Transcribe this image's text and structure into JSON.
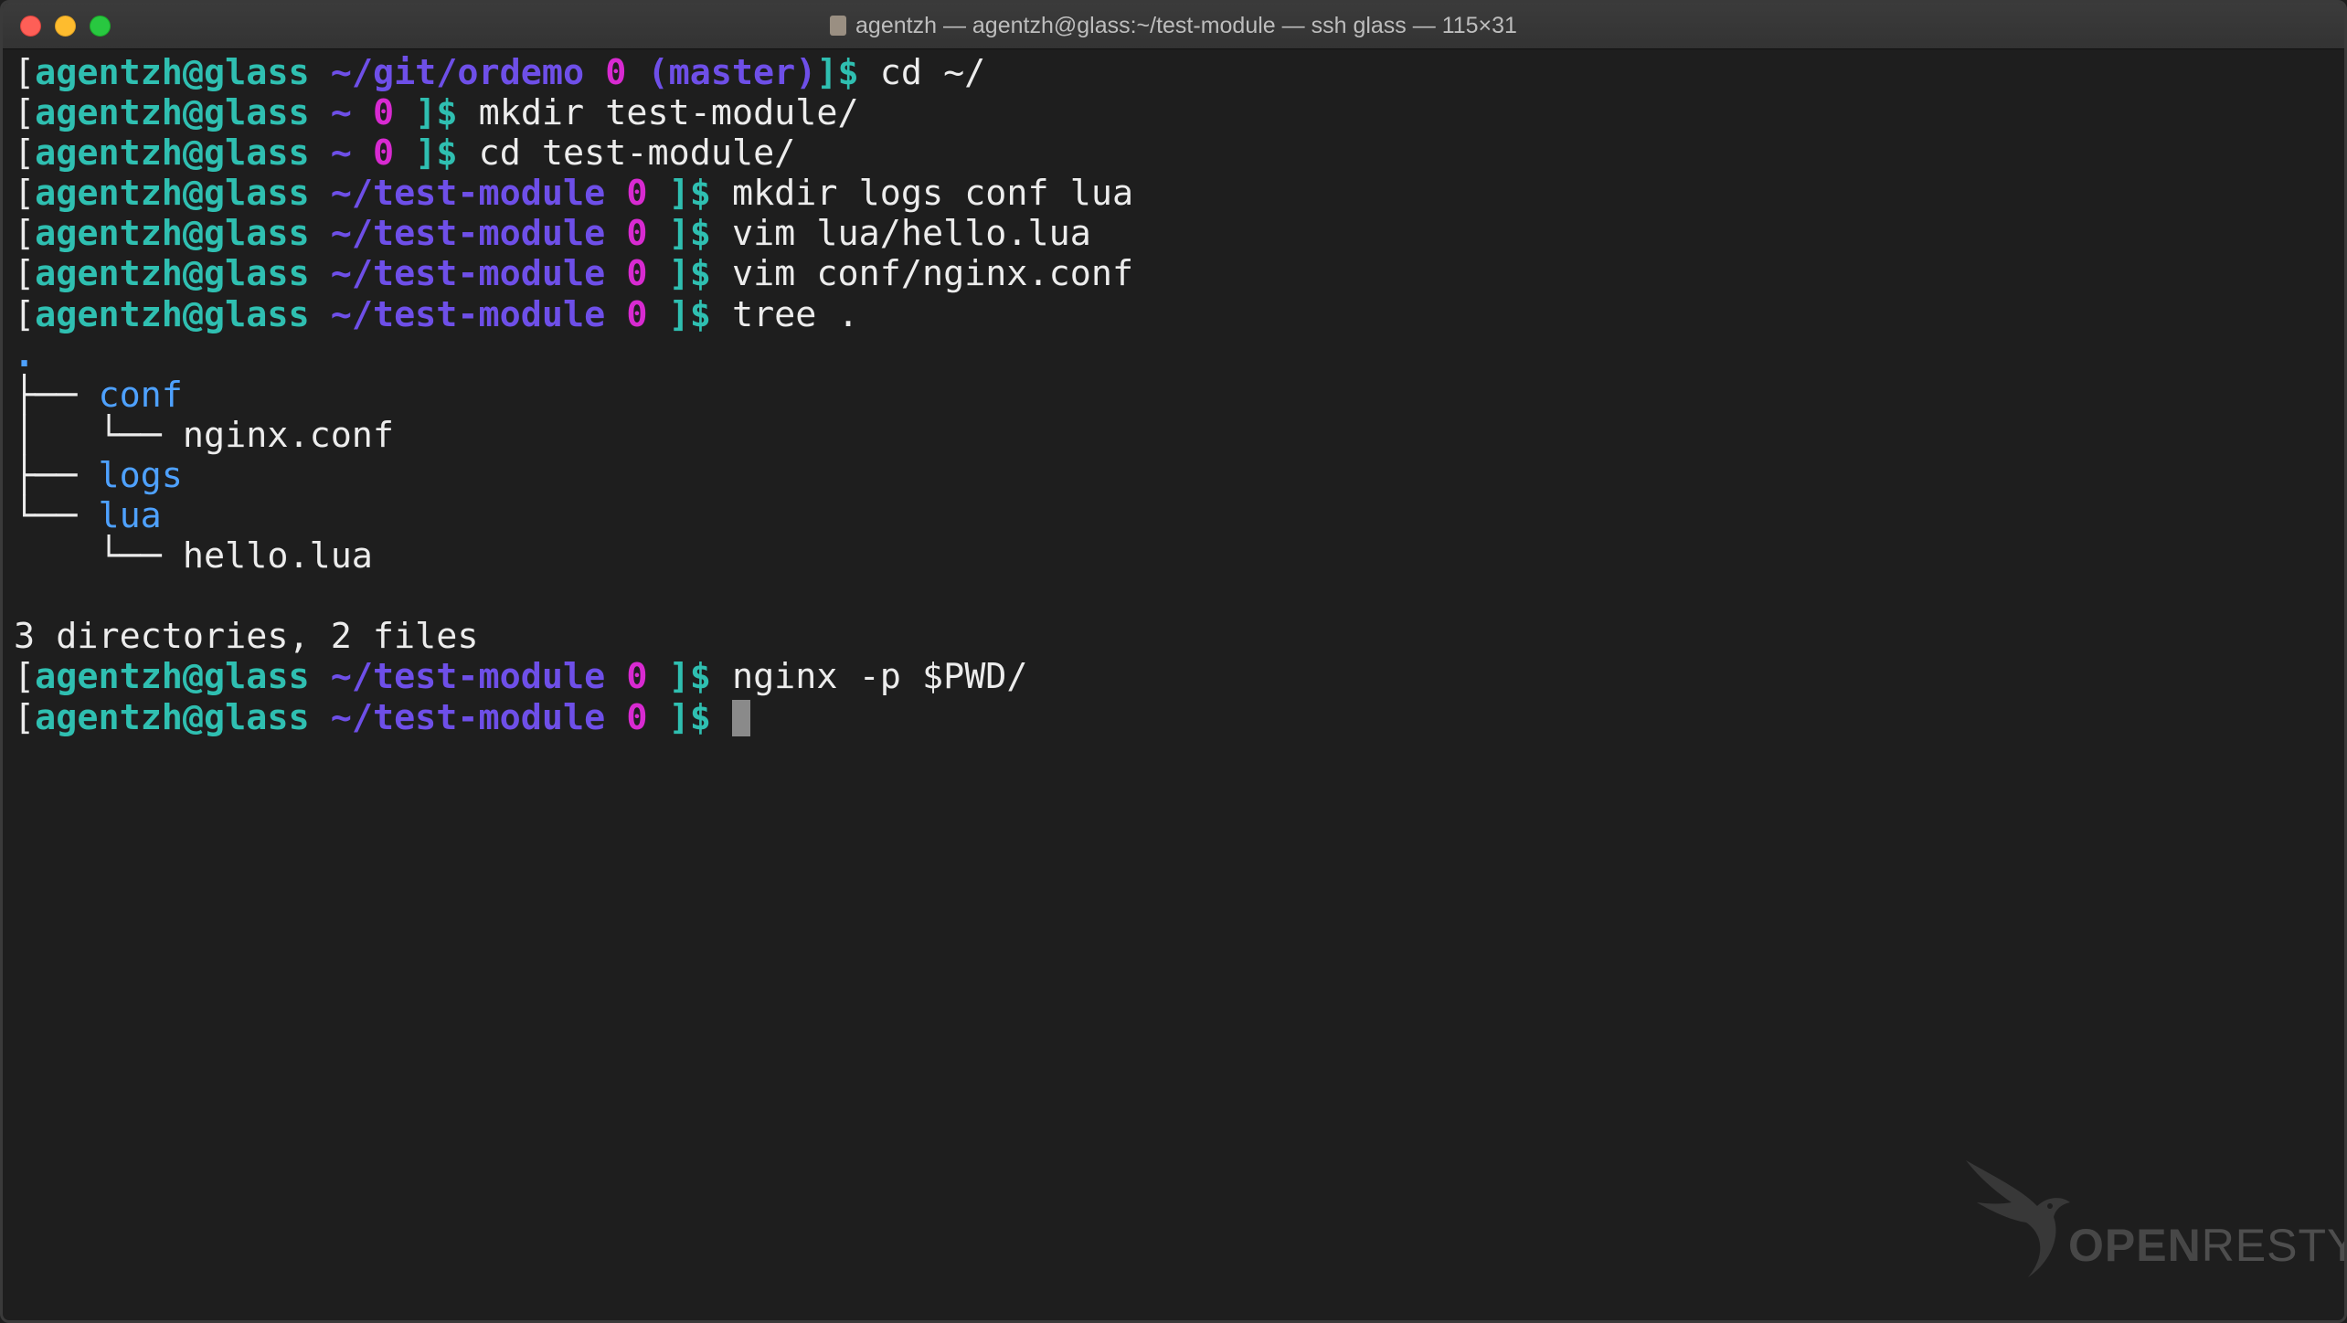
{
  "window": {
    "title": "agentzh — agentzh@glass:~/test-module — ssh glass — 115×31"
  },
  "prompts": [
    {
      "user": "agentzh@glass",
      "path": "~/git/ordemo",
      "status": "0",
      "branch": "(master)",
      "close": "]$",
      "cmd": "cd ~/"
    },
    {
      "user": "agentzh@glass",
      "path": "~",
      "status": "0",
      "close": "]$",
      "cmd": "mkdir test-module/"
    },
    {
      "user": "agentzh@glass",
      "path": "~",
      "status": "0",
      "close": "]$",
      "cmd": "cd test-module/"
    },
    {
      "user": "agentzh@glass",
      "path": "~/test-module",
      "status": "0",
      "close": "]$",
      "cmd": "mkdir logs conf lua"
    },
    {
      "user": "agentzh@glass",
      "path": "~/test-module",
      "status": "0",
      "close": "]$",
      "cmd": "vim lua/hello.lua"
    },
    {
      "user": "agentzh@glass",
      "path": "~/test-module",
      "status": "0",
      "close": "]$",
      "cmd": "vim conf/nginx.conf"
    },
    {
      "user": "agentzh@glass",
      "path": "~/test-module",
      "status": "0",
      "close": "]$",
      "cmd": "tree ."
    }
  ],
  "tree_output": {
    "root": ".",
    "conf": {
      "branch": "├── ",
      "name": "conf"
    },
    "nginx_conf": {
      "branch": "│   └── ",
      "name": "nginx.conf"
    },
    "logs": {
      "branch": "├── ",
      "name": "logs"
    },
    "lua": {
      "branch": "└── ",
      "name": "lua"
    },
    "hello_lua": {
      "branch": "    └── ",
      "name": "hello.lua"
    },
    "summary": "3 directories, 2 files"
  },
  "prompts_after": [
    {
      "user": "agentzh@glass",
      "path": "~/test-module",
      "status": "0",
      "close": "]$",
      "cmd": "nginx -p $PWD/"
    },
    {
      "user": "agentzh@glass",
      "path": "~/test-module",
      "status": "0",
      "close": "]$",
      "cmd": ""
    }
  ],
  "watermark": {
    "text_heavy": "OPEN",
    "text_light": "RESTY"
  },
  "colors": {
    "background": "#1e1e1e",
    "user": "#2fbfb1",
    "path": "#6e4fe8",
    "status": "#d82ad1",
    "dir": "#4ea1ff",
    "text": "#ececec"
  },
  "icons": [
    "close-icon",
    "minimize-icon",
    "zoom-icon",
    "folder-icon",
    "openresty-logo"
  ]
}
